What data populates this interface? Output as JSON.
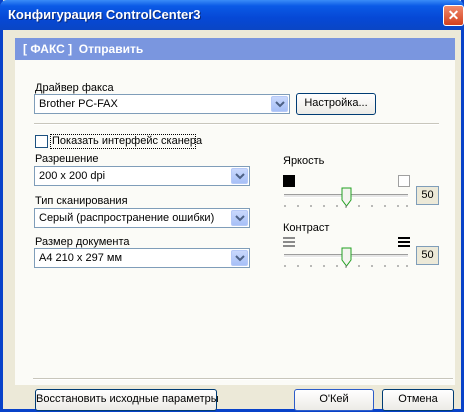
{
  "window": {
    "title": "Конфигурация ControlCenter3",
    "close_glyph": "✕"
  },
  "tab": {
    "label": "[ ФАКС ]  Отправить"
  },
  "fax_driver": {
    "label": "Драйвер факса",
    "value": "Brother PC-FAX",
    "settings_button": "Настройка..."
  },
  "scanner_ui_checkbox": {
    "label": "Показать интерфейс сканера",
    "checked": false
  },
  "resolution": {
    "label": "Разрешение",
    "value": "200 x 200 dpi"
  },
  "scan_type": {
    "label": "Тип сканирования",
    "value": "Серый (распространение ошибки)"
  },
  "document_size": {
    "label": "Размер документа",
    "value": "A4 210 x 297 мм"
  },
  "brightness": {
    "label": "Яркость",
    "value": "50",
    "level": 0.5
  },
  "contrast": {
    "label": "Контраст",
    "value": "50",
    "level": 0.5
  },
  "footer": {
    "restore_button": "Восстановить исходные параметры",
    "ok_button": "O'Кей",
    "cancel_button": "Отмена"
  },
  "colors": {
    "title_bar": "#0a5ae6",
    "tab_bar": "#7a96df",
    "dialog_bg": "#ece9d8"
  },
  "icons": {
    "close": "close-icon",
    "dropdown": "chevron-down-icon",
    "brightness_low": "brightness-dark-icon",
    "brightness_high": "brightness-light-icon",
    "contrast_low": "contrast-low-icon",
    "contrast_high": "contrast-high-icon"
  }
}
